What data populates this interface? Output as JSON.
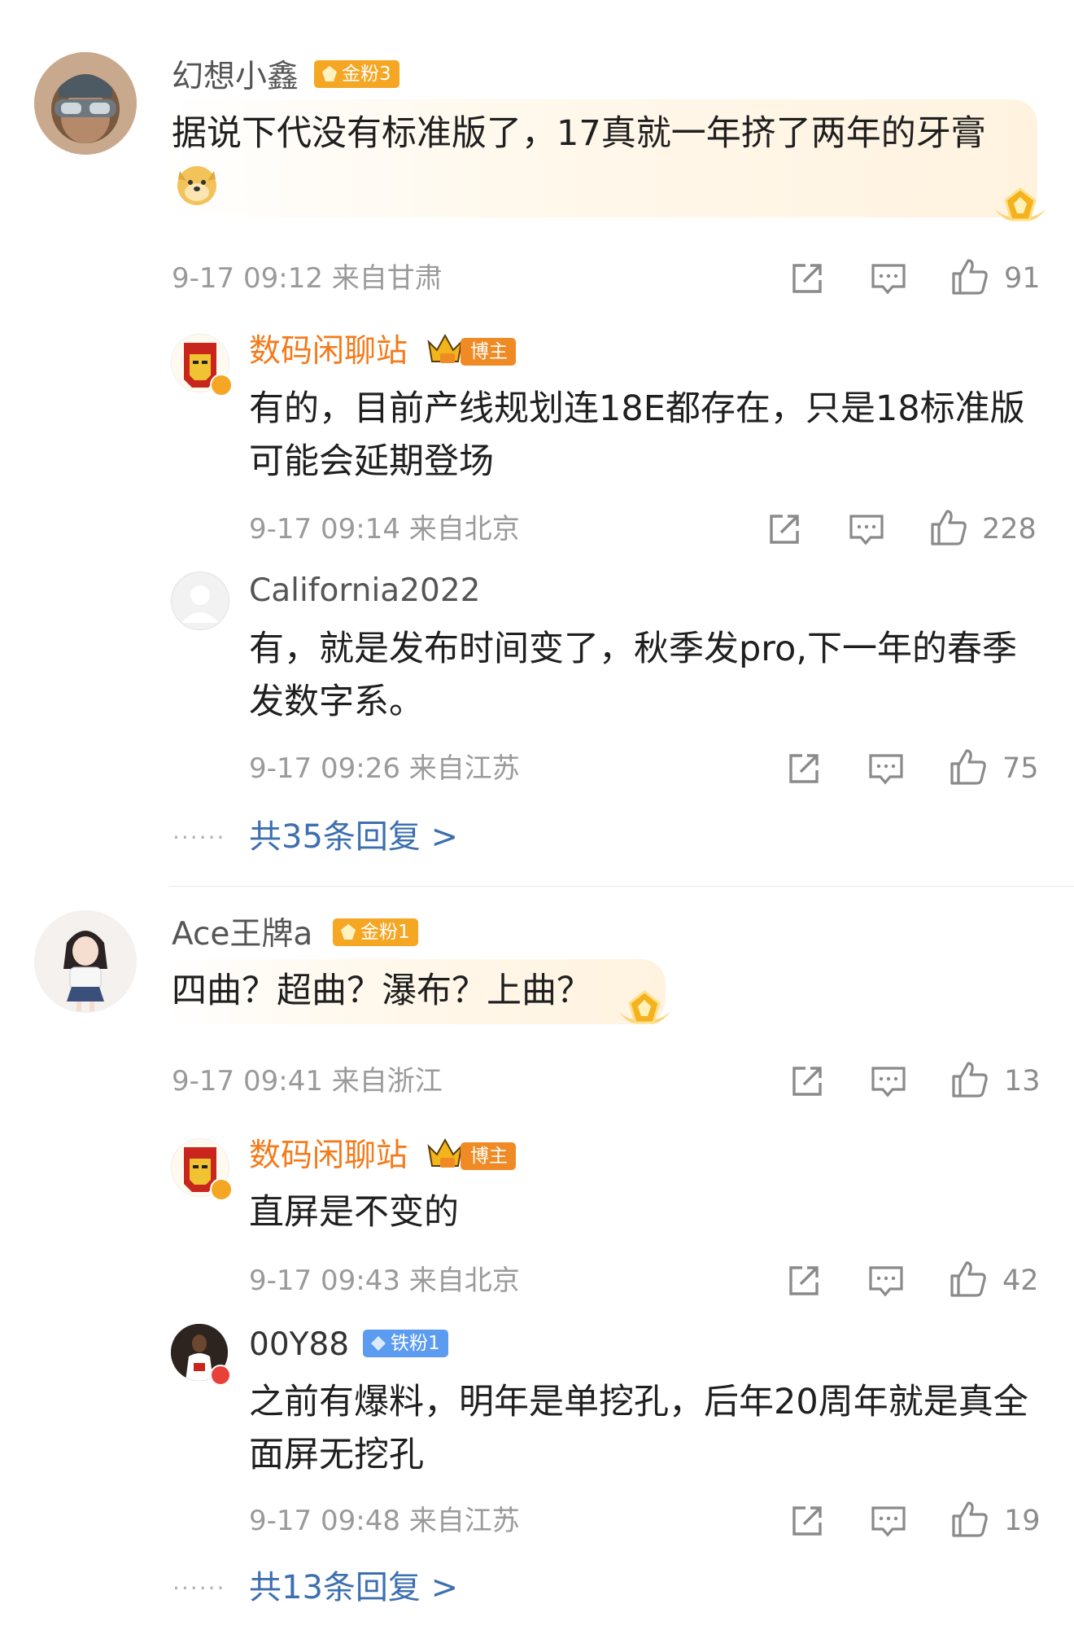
{
  "comments": [
    {
      "user": "幻想小鑫",
      "badge": "金粉3",
      "text": "据说下代没有标准版了，17真就一年挤了两年的牙膏",
      "time": "9-17 09:12",
      "location": "来自甘肃",
      "likes": "91",
      "replies": [
        {
          "user": "数码闲聊站",
          "badge": "博主",
          "text": "有的，目前产线规划连18E都存在，只是18标准版可能会延期登场",
          "time": "9-17 09:14",
          "location": "来自北京",
          "likes": "228"
        },
        {
          "user": "California2022",
          "text": "有，就是发布时间变了，秋季发pro,下一年的春季发数字系。",
          "time": "9-17 09:26",
          "location": "来自江苏",
          "likes": "75"
        }
      ],
      "more_replies": "共35条回复 >"
    },
    {
      "user": "Ace王牌a",
      "badge": "金粉1",
      "text": "四曲？超曲？瀑布？上曲？",
      "time": "9-17 09:41",
      "location": "来自浙江",
      "likes": "13",
      "replies": [
        {
          "user": "数码闲聊站",
          "badge": "博主",
          "text": "直屏是不变的",
          "time": "9-17 09:43",
          "location": "来自北京",
          "likes": "42"
        },
        {
          "user": "00Y88",
          "badge": "铁粉1",
          "text": "之前有爆料，明年是单挖孔，后年20周年就是真全面屏无挖孔",
          "time": "9-17 09:48",
          "location": "来自江苏",
          "likes": "19"
        }
      ],
      "more_replies": "共13条回复 >"
    }
  ],
  "dots": "······",
  "colors": {
    "blogger_name": "#f47a1a",
    "gold_badge": "#f5a623",
    "iron_badge": "#5b9bf0",
    "blogger_badge": "#f08a24",
    "link": "#3d6fb0"
  },
  "icons": [
    "share-icon",
    "comment-icon",
    "like-icon",
    "crown-icon",
    "doge-emoji",
    "gold-fan-star-icon"
  ]
}
